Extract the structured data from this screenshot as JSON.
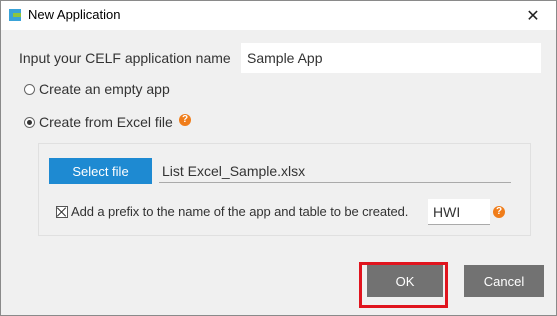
{
  "window": {
    "title": "New Application",
    "close_glyph": "✕"
  },
  "form": {
    "name_label": "Input your CELF application name",
    "name_value": "Sample App",
    "option_empty": "Create an empty app",
    "option_excel": "Create from Excel file",
    "selected_option": "excel"
  },
  "excel": {
    "select_file_label": "Select file",
    "file_name": "List Excel_Sample.xlsx",
    "prefix_label": "Add a prefix to the name of the app and table to be created.",
    "prefix_checked": true,
    "prefix_value": "HWI"
  },
  "help_glyph": "?",
  "buttons": {
    "ok_label": "OK",
    "cancel_label": "Cancel"
  },
  "colors": {
    "accent": "#1e8ad2",
    "help": "#f07d1a",
    "highlight": "#e0141e",
    "button_gray": "#727272"
  }
}
